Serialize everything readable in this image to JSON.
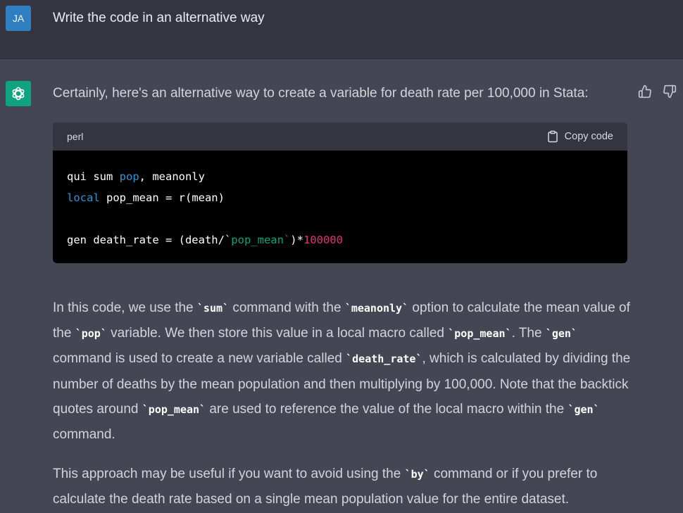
{
  "user": {
    "avatar_initials": "JA",
    "message": "Write the code in an alternative way"
  },
  "assistant": {
    "intro": "Certainly, here's an alternative way to create a variable for death rate per 100,000 in Stata:",
    "code_language": "perl",
    "copy_label": "Copy code",
    "code": {
      "line1_a": "qui sum ",
      "line1_b": "pop",
      "line1_c": ", meanonly",
      "line2_a": "local",
      "line2_b": " pop_mean = r(mean)",
      "line4_a": "gen death_rate = (death/`",
      "line4_b": "pop_mean`",
      "line4_c": ")*",
      "line4_d": "100000"
    },
    "p1": {
      "t1": "In this code, we use the ",
      "c1": "`sum`",
      "t2": " command with the ",
      "c2": "`meanonly`",
      "t3": " option to calculate the mean value of the ",
      "c3": "`pop`",
      "t4": " variable. We then store this value in a local macro called ",
      "c4": "`pop_mean`",
      "t5": ". The ",
      "c5": "`gen`",
      "t6": " command is used to create a new variable called ",
      "c6": "`death_rate`",
      "t7": ", which is calculated by dividing the number of deaths by the mean population and then multiplying by 100,000. Note that the backtick quotes around ",
      "c7": "`pop_mean`",
      "t8": " are used to reference the value of the local macro within the ",
      "c8": "`gen`",
      "t9": " command."
    },
    "p2": {
      "t1": "This approach may be useful if you want to avoid using the ",
      "c1": "`by`",
      "t2": " command or if you prefer to calculate the death rate based on a single mean population value for the entire dataset."
    }
  },
  "colors": {
    "user_bg": "#343541",
    "assistant_bg": "#444654",
    "avatar_user": "#2f7ec0",
    "avatar_ai": "#10a37f",
    "code_keyword": "#2e95d3",
    "code_string": "#00a67d",
    "code_number": "#df3079"
  },
  "icons": {
    "assistant_avatar": "openai-logo-icon",
    "copy": "clipboard-icon",
    "like": "thumbs-up-icon",
    "dislike": "thumbs-down-icon"
  }
}
